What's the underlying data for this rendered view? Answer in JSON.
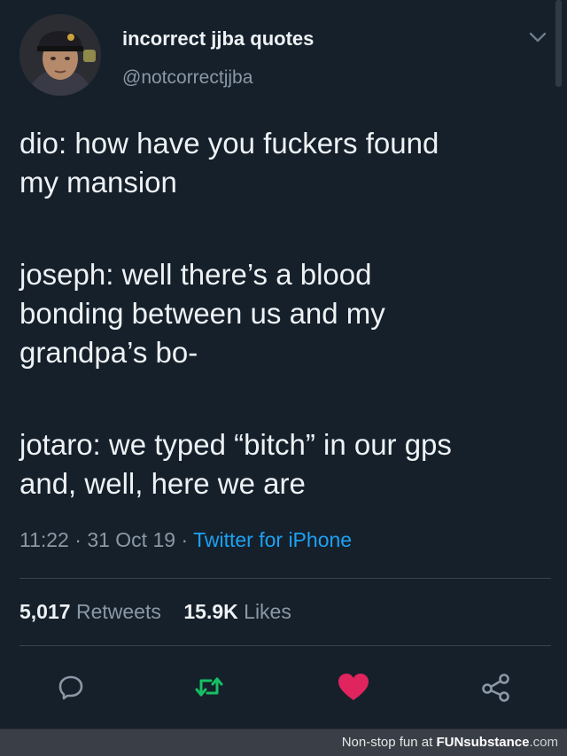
{
  "tweet": {
    "display_name": "incorrect jjba quotes",
    "handle": "@notcorrectjjba",
    "avatar_icon": "avatar-portrait",
    "menu_icon": "chevron-down-icon",
    "lines": [
      "dio: how have you fuckers found",
      "my mansion",
      "joseph: well there’s a blood",
      "bonding between us and my",
      "grandpa’s bo-",
      "jotaro: we typed “bitch” in our gps",
      "and, well, here we are"
    ],
    "time": "11:22",
    "date": "31 Oct 19",
    "separator": "·",
    "source": "Twitter for iPhone",
    "retweets_count": "5,017",
    "retweets_label": "Retweets",
    "likes_count": "15.9K",
    "likes_label": "Likes"
  },
  "actions": {
    "reply_icon": "reply-icon",
    "retweet_icon": "retweet-icon",
    "like_icon": "heart-icon",
    "share_icon": "share-icon",
    "retweet_color": "#17bf63",
    "like_color": "#e0245e"
  },
  "footer": {
    "tagline": "Non-stop fun at",
    "brand_fun": "FUN",
    "brand_substance": "substance",
    "brand_domain": ".com"
  },
  "colors": {
    "background": "#15202b",
    "text": "#eef2f5",
    "muted": "#8b98a5",
    "link": "#1da1f2"
  }
}
